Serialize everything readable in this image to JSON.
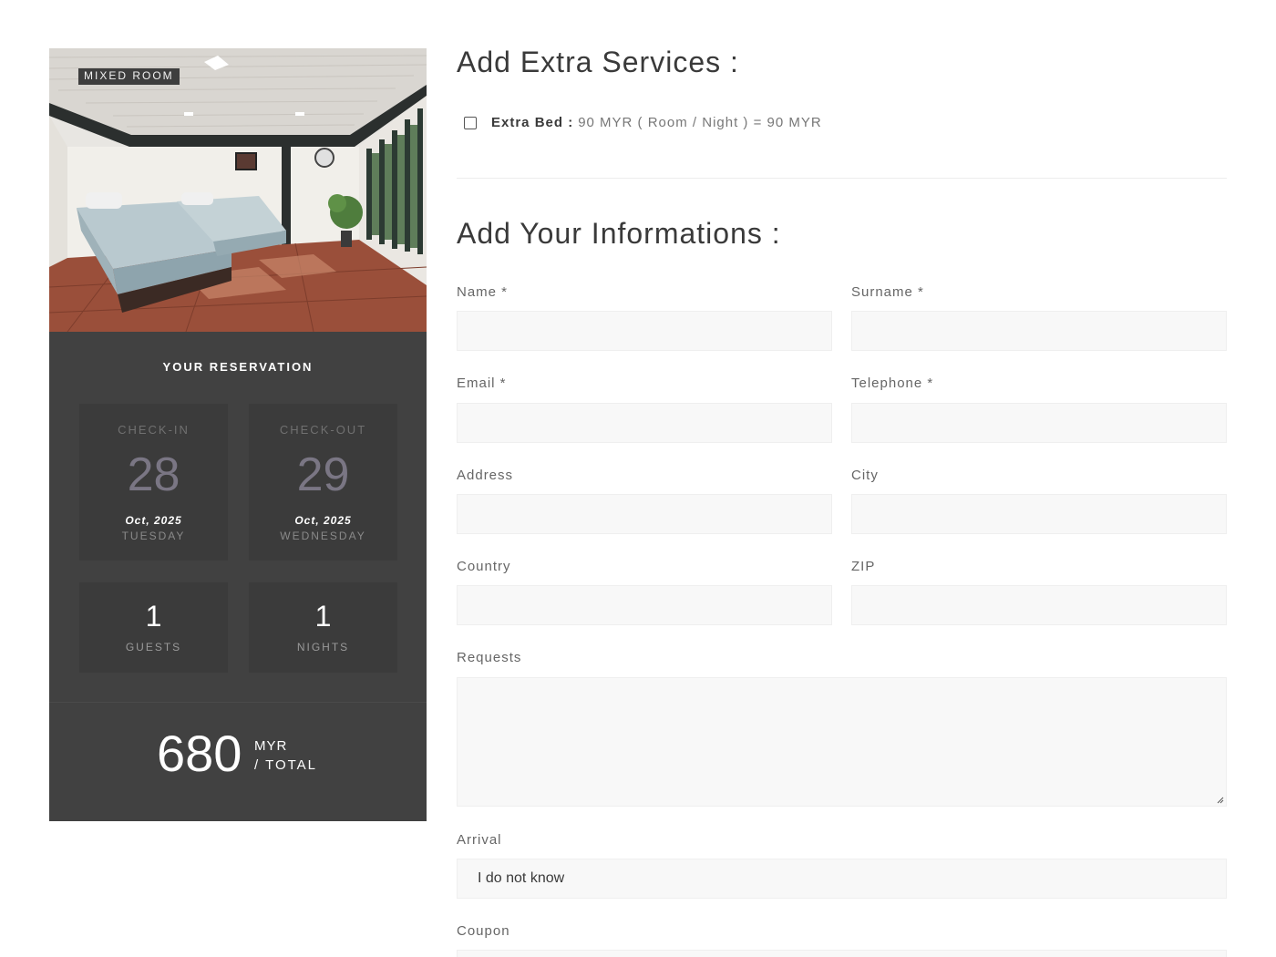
{
  "room": {
    "tag": "MIXED ROOM"
  },
  "reservation": {
    "title": "YOUR RESERVATION",
    "checkin": {
      "label": "CHECK-IN",
      "day": "28",
      "month": "Oct, 2025",
      "weekday": "TUESDAY"
    },
    "checkout": {
      "label": "CHECK-OUT",
      "day": "29",
      "month": "Oct, 2025",
      "weekday": "WEDNESDAY"
    },
    "guests": {
      "count": "1",
      "label": "GUESTS"
    },
    "nights": {
      "count": "1",
      "label": "NIGHTS"
    },
    "total": {
      "price": "680",
      "currency": "MYR",
      "per": "/ TOTAL"
    }
  },
  "extras": {
    "heading": "Add Extra Services :",
    "items": [
      {
        "name": "Extra Bed :",
        "detail": "90 MYR ( Room / Night ) = 90 MYR",
        "checked": false
      }
    ]
  },
  "info": {
    "heading": "Add Your Informations :",
    "fields": {
      "name": {
        "label": "Name *",
        "value": ""
      },
      "surname": {
        "label": "Surname *",
        "value": ""
      },
      "email": {
        "label": "Email *",
        "value": ""
      },
      "telephone": {
        "label": "Telephone *",
        "value": ""
      },
      "address": {
        "label": "Address",
        "value": ""
      },
      "city": {
        "label": "City",
        "value": ""
      },
      "country": {
        "label": "Country",
        "value": ""
      },
      "zip": {
        "label": "ZIP",
        "value": ""
      },
      "requests": {
        "label": "Requests",
        "value": ""
      },
      "arrival": {
        "label": "Arrival",
        "value": "I do not know"
      },
      "coupon": {
        "label": "Coupon",
        "value": ""
      }
    }
  },
  "colors": {
    "card_bg": "#414141",
    "box_bg": "#3b3b3b",
    "input_bg": "#f8f8f8",
    "day_number": "#7a7684"
  }
}
